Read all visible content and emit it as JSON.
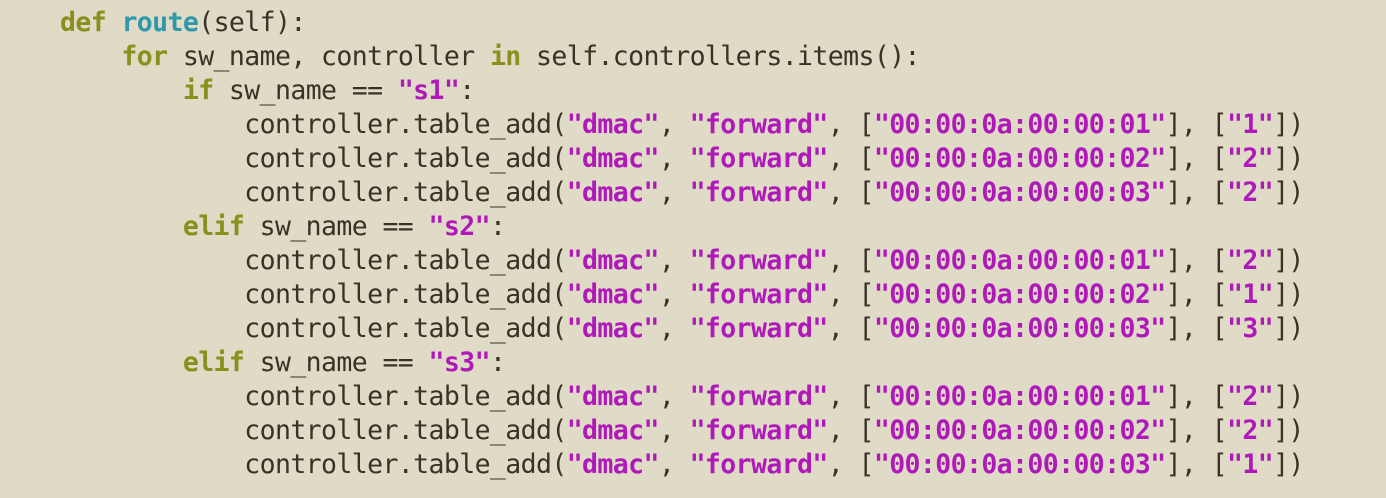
{
  "colors": {
    "background": "#e0dbc7",
    "keyword": "#8b8f1d",
    "function_name": "#2f98aa",
    "string": "#b019b9",
    "plain": "#3a3226"
  },
  "lines": [
    [
      {
        "t": "def",
        "c": "kw"
      },
      {
        "t": " ",
        "c": "pl"
      },
      {
        "t": "route",
        "c": "fn"
      },
      {
        "t": "(self):",
        "c": "pl"
      }
    ],
    [
      {
        "t": "    ",
        "c": "pl"
      },
      {
        "t": "for",
        "c": "kw"
      },
      {
        "t": " sw_name, controller ",
        "c": "pl"
      },
      {
        "t": "in",
        "c": "kw"
      },
      {
        "t": " self.controllers.items():",
        "c": "pl"
      }
    ],
    [
      {
        "t": "        ",
        "c": "pl"
      },
      {
        "t": "if",
        "c": "kw"
      },
      {
        "t": " sw_name == ",
        "c": "pl"
      },
      {
        "t": "\"s1\"",
        "c": "st"
      },
      {
        "t": ":",
        "c": "pl"
      }
    ],
    [
      {
        "t": "            controller.table_add(",
        "c": "pl"
      },
      {
        "t": "\"dmac\"",
        "c": "st"
      },
      {
        "t": ", ",
        "c": "pl"
      },
      {
        "t": "\"forward\"",
        "c": "st"
      },
      {
        "t": ", [",
        "c": "pl"
      },
      {
        "t": "\"00:00:0a:00:00:01\"",
        "c": "st"
      },
      {
        "t": "], [",
        "c": "pl"
      },
      {
        "t": "\"1\"",
        "c": "st"
      },
      {
        "t": "])",
        "c": "pl"
      }
    ],
    [
      {
        "t": "            controller.table_add(",
        "c": "pl"
      },
      {
        "t": "\"dmac\"",
        "c": "st"
      },
      {
        "t": ", ",
        "c": "pl"
      },
      {
        "t": "\"forward\"",
        "c": "st"
      },
      {
        "t": ", [",
        "c": "pl"
      },
      {
        "t": "\"00:00:0a:00:00:02\"",
        "c": "st"
      },
      {
        "t": "], [",
        "c": "pl"
      },
      {
        "t": "\"2\"",
        "c": "st"
      },
      {
        "t": "])",
        "c": "pl"
      }
    ],
    [
      {
        "t": "            controller.table_add(",
        "c": "pl"
      },
      {
        "t": "\"dmac\"",
        "c": "st"
      },
      {
        "t": ", ",
        "c": "pl"
      },
      {
        "t": "\"forward\"",
        "c": "st"
      },
      {
        "t": ", [",
        "c": "pl"
      },
      {
        "t": "\"00:00:0a:00:00:03\"",
        "c": "st"
      },
      {
        "t": "], [",
        "c": "pl"
      },
      {
        "t": "\"2\"",
        "c": "st"
      },
      {
        "t": "])",
        "c": "pl"
      }
    ],
    [
      {
        "t": "        ",
        "c": "pl"
      },
      {
        "t": "elif",
        "c": "kw"
      },
      {
        "t": " sw_name == ",
        "c": "pl"
      },
      {
        "t": "\"s2\"",
        "c": "st"
      },
      {
        "t": ":",
        "c": "pl"
      }
    ],
    [
      {
        "t": "            controller.table_add(",
        "c": "pl"
      },
      {
        "t": "\"dmac\"",
        "c": "st"
      },
      {
        "t": ", ",
        "c": "pl"
      },
      {
        "t": "\"forward\"",
        "c": "st"
      },
      {
        "t": ", [",
        "c": "pl"
      },
      {
        "t": "\"00:00:0a:00:00:01\"",
        "c": "st"
      },
      {
        "t": "], [",
        "c": "pl"
      },
      {
        "t": "\"2\"",
        "c": "st"
      },
      {
        "t": "])",
        "c": "pl"
      }
    ],
    [
      {
        "t": "            controller.table_add(",
        "c": "pl"
      },
      {
        "t": "\"dmac\"",
        "c": "st"
      },
      {
        "t": ", ",
        "c": "pl"
      },
      {
        "t": "\"forward\"",
        "c": "st"
      },
      {
        "t": ", [",
        "c": "pl"
      },
      {
        "t": "\"00:00:0a:00:00:02\"",
        "c": "st"
      },
      {
        "t": "], [",
        "c": "pl"
      },
      {
        "t": "\"1\"",
        "c": "st"
      },
      {
        "t": "])",
        "c": "pl"
      }
    ],
    [
      {
        "t": "            controller.table_add(",
        "c": "pl"
      },
      {
        "t": "\"dmac\"",
        "c": "st"
      },
      {
        "t": ", ",
        "c": "pl"
      },
      {
        "t": "\"forward\"",
        "c": "st"
      },
      {
        "t": ", [",
        "c": "pl"
      },
      {
        "t": "\"00:00:0a:00:00:03\"",
        "c": "st"
      },
      {
        "t": "], [",
        "c": "pl"
      },
      {
        "t": "\"3\"",
        "c": "st"
      },
      {
        "t": "])",
        "c": "pl"
      }
    ],
    [
      {
        "t": "        ",
        "c": "pl"
      },
      {
        "t": "elif",
        "c": "kw"
      },
      {
        "t": " sw_name == ",
        "c": "pl"
      },
      {
        "t": "\"s3\"",
        "c": "st"
      },
      {
        "t": ":",
        "c": "pl"
      }
    ],
    [
      {
        "t": "            controller.table_add(",
        "c": "pl"
      },
      {
        "t": "\"dmac\"",
        "c": "st"
      },
      {
        "t": ", ",
        "c": "pl"
      },
      {
        "t": "\"forward\"",
        "c": "st"
      },
      {
        "t": ", [",
        "c": "pl"
      },
      {
        "t": "\"00:00:0a:00:00:01\"",
        "c": "st"
      },
      {
        "t": "], [",
        "c": "pl"
      },
      {
        "t": "\"2\"",
        "c": "st"
      },
      {
        "t": "])",
        "c": "pl"
      }
    ],
    [
      {
        "t": "            controller.table_add(",
        "c": "pl"
      },
      {
        "t": "\"dmac\"",
        "c": "st"
      },
      {
        "t": ", ",
        "c": "pl"
      },
      {
        "t": "\"forward\"",
        "c": "st"
      },
      {
        "t": ", [",
        "c": "pl"
      },
      {
        "t": "\"00:00:0a:00:00:02\"",
        "c": "st"
      },
      {
        "t": "], [",
        "c": "pl"
      },
      {
        "t": "\"2\"",
        "c": "st"
      },
      {
        "t": "])",
        "c": "pl"
      }
    ],
    [
      {
        "t": "            controller.table_add(",
        "c": "pl"
      },
      {
        "t": "\"dmac\"",
        "c": "st"
      },
      {
        "t": ", ",
        "c": "pl"
      },
      {
        "t": "\"forward\"",
        "c": "st"
      },
      {
        "t": ", [",
        "c": "pl"
      },
      {
        "t": "\"00:00:0a:00:00:03\"",
        "c": "st"
      },
      {
        "t": "], [",
        "c": "pl"
      },
      {
        "t": "\"1\"",
        "c": "st"
      },
      {
        "t": "])",
        "c": "pl"
      }
    ]
  ]
}
